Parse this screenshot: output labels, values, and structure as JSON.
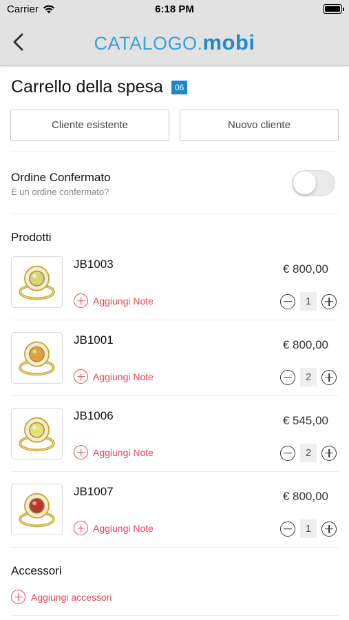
{
  "status_bar": {
    "carrier": "Carrier",
    "time": "6:18 PM"
  },
  "nav": {
    "logo_light": "CATALOGO.",
    "logo_bold": "mobi"
  },
  "cart": {
    "title": "Carrello della spesa",
    "count": "06"
  },
  "client_buttons": {
    "existing": "Cliente esistente",
    "new": "Nuovo cliente"
  },
  "order": {
    "label": "Ordine Confermato",
    "sublabel": "È un ordine confermato?",
    "confirmed": false
  },
  "products_section": {
    "label": "Prodotti",
    "items": [
      {
        "sku": "JB1003",
        "price": "€ 800,00",
        "note_label": "Aggiungi Note",
        "qty": "1",
        "stone": "#d8d47a"
      },
      {
        "sku": "JB1001",
        "price": "€ 800,00",
        "note_label": "Aggiungi Note",
        "qty": "2",
        "stone": "#e0a040"
      },
      {
        "sku": "JB1006",
        "price": "€ 545,00",
        "note_label": "Aggiungi Note",
        "qty": "2",
        "stone": "#e6e07a"
      },
      {
        "sku": "JB1007",
        "price": "€ 800,00",
        "note_label": "Aggiungi Note",
        "qty": "1",
        "stone": "#b83a2a"
      }
    ]
  },
  "accessories_section": {
    "label": "Accessori",
    "add_label": "Aggiungi accessori"
  },
  "colors": {
    "accent_blue": "#1c86c8",
    "accent_red": "#e8434f",
    "gold": "#c9a83a"
  }
}
